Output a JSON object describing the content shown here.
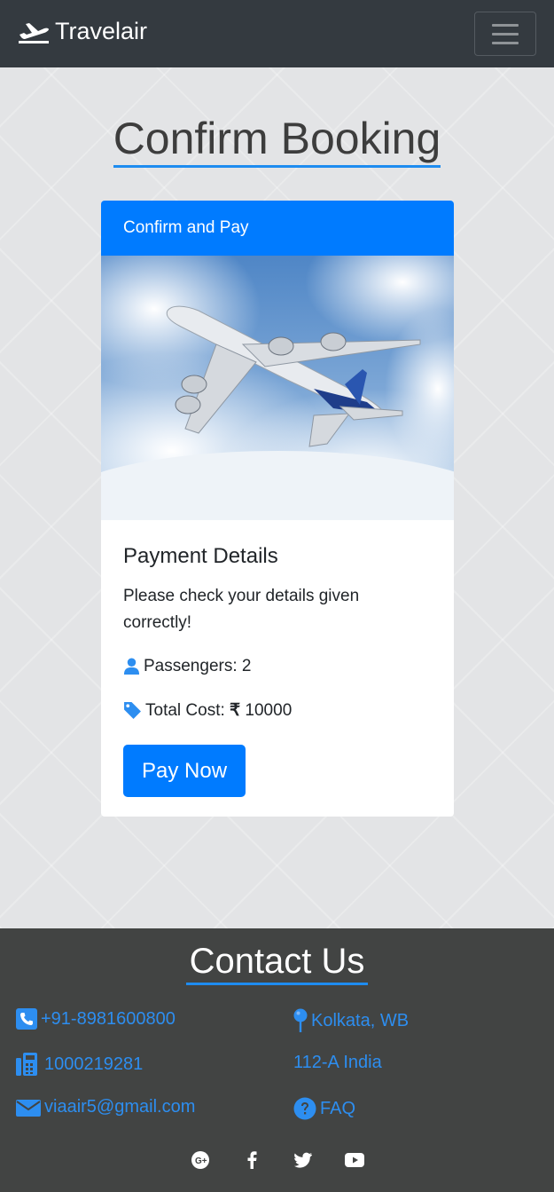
{
  "navbar": {
    "brand": "Travelair",
    "brand_icon": "airplane-departure-icon",
    "menu_icon": "hamburger-menu-icon"
  },
  "page": {
    "title": "Confirm Booking"
  },
  "card": {
    "header": "Confirm and Pay",
    "image": "airplane-in-sky-photo",
    "title": "Payment Details",
    "text": "Please check your details given correctly!",
    "passengers_label": "Passengers:",
    "passengers_value": "2",
    "cost_label": "Total Cost:",
    "currency_symbol": "₹",
    "cost_value": "10000",
    "pay_button": "Pay Now"
  },
  "footer": {
    "title": "Contact Us",
    "phone": "+91-8981600800",
    "fax": "1000219281",
    "email": "viaair5@gmail.com",
    "location": "Kolkata, WB",
    "address": "112-A India",
    "faq": "FAQ",
    "socials": [
      "google-plus-icon",
      "facebook-icon",
      "twitter-icon",
      "youtube-icon"
    ]
  },
  "colors": {
    "accent": "#007bff",
    "link": "#2d8ef0",
    "navbar_bg": "#343a40",
    "footer_bg": "#424443"
  }
}
